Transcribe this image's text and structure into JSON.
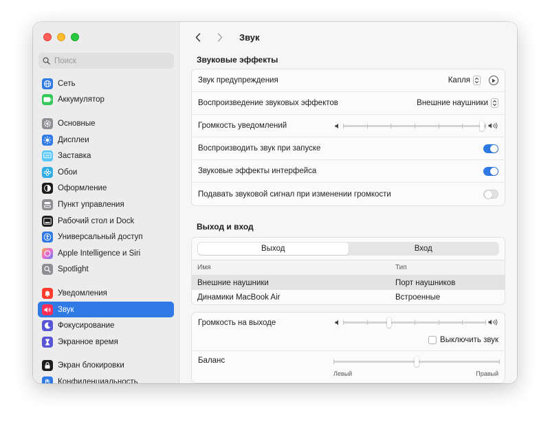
{
  "sidebar": {
    "search_placeholder": "Поиск",
    "items": [
      {
        "label": "Сеть",
        "icon": "globe-icon",
        "color": "#2f7ae5"
      },
      {
        "label": "Аккумулятор",
        "icon": "battery-icon",
        "color": "#34c759"
      },
      {
        "label": "Основные",
        "icon": "gear-icon",
        "color": "#8e8e93"
      },
      {
        "label": "Дисплеи",
        "icon": "sun-icon",
        "color": "#2f7ae5"
      },
      {
        "label": "Заставка",
        "icon": "screensaver-icon",
        "color": "#5ac8fa"
      },
      {
        "label": "Обои",
        "icon": "flower-icon",
        "color": "#32ade6"
      },
      {
        "label": "Оформление",
        "icon": "appearance-icon",
        "color": "#1c1c1e"
      },
      {
        "label": "Пункт управления",
        "icon": "control-center-icon",
        "color": "#8e8e93"
      },
      {
        "label": "Рабочий стол и Dock",
        "icon": "dock-icon",
        "color": "#1c1c1e"
      },
      {
        "label": "Универсальный доступ",
        "icon": "accessibility-icon",
        "color": "#2f7ae5"
      },
      {
        "label": "Apple Intelligence и Siri",
        "icon": "siri-icon",
        "color": "#e86bd0"
      },
      {
        "label": "Spotlight",
        "icon": "spotlight-icon",
        "color": "#8e8e93"
      },
      {
        "label": "Уведомления",
        "icon": "bell-icon",
        "color": "#ff3b30"
      },
      {
        "label": "Звук",
        "icon": "speaker-icon",
        "color": "#ff2d55"
      },
      {
        "label": "Фокусирование",
        "icon": "moon-icon",
        "color": "#5856d6"
      },
      {
        "label": "Экранное время",
        "icon": "hourglass-icon",
        "color": "#5856d6"
      },
      {
        "label": "Экран блокировки",
        "icon": "lock-icon",
        "color": "#1c1c1e"
      },
      {
        "label": "Конфиденциальность",
        "icon": "hand-icon",
        "color": "#2f7ae5"
      }
    ]
  },
  "header": {
    "title": "Звук"
  },
  "effects": {
    "title": "Звуковые эффекты",
    "alert_sound_label": "Звук предупреждения",
    "alert_sound_value": "Капля",
    "play_effects_label": "Воспроизведение звуковых эффектов",
    "play_effects_value": "Внешние наушники",
    "alert_volume_label": "Громкость уведомлений",
    "alert_volume_level": 0.97,
    "startup_label": "Воспроизводить звук при запуске",
    "startup_on": true,
    "ui_effects_label": "Звуковые эффекты интерфейса",
    "ui_effects_on": true,
    "volume_feedback_label": "Подавать звуковой сигнал при изменении громкости",
    "volume_feedback_on": false
  },
  "io": {
    "title": "Выход и вход",
    "tabs": [
      "Выход",
      "Вход"
    ],
    "active_tab": 0,
    "columns": {
      "name": "Имя",
      "type": "Тип"
    },
    "devices": [
      {
        "name": "Внешние наушники",
        "type": "Порт наушников",
        "selected": true
      },
      {
        "name": "Динамики MacBook Air",
        "type": "Встроенные",
        "selected": false
      }
    ],
    "output_volume_label": "Громкость на выходе",
    "output_volume_level": 0.32,
    "mute_label": "Выключить звук",
    "mute_checked": false,
    "balance_label": "Баланс",
    "balance_level": 0.5,
    "balance_left": "Левый",
    "balance_right": "Правый"
  }
}
